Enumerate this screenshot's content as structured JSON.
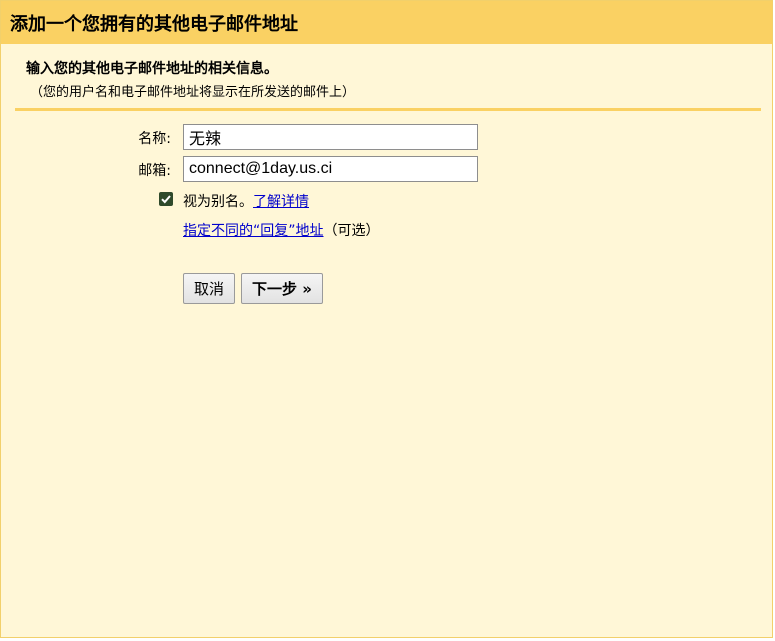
{
  "dialog": {
    "title": "添加一个您拥有的其他电子邮件地址",
    "heading": "输入您的其他电子邮件地址的相关信息。",
    "subheading": "（您的用户名和电子邮件地址将显示在所发送的邮件上）"
  },
  "form": {
    "name_label": "名称:",
    "name_value": "无辣",
    "email_label": "邮箱:",
    "email_value": "connect@1day.us.ci",
    "alias_checked": true,
    "alias_label": "视为别名。",
    "learn_more_link": "了解详情",
    "reply_to_link": "指定不同的“回复”地址",
    "optional_text": "（可选）"
  },
  "buttons": {
    "cancel_label": "取消",
    "next_label": "下一步 »"
  },
  "colors": {
    "title_bar": "#fad163",
    "panel_bg": "#fff7d7",
    "checkbox_fill": "#2f4a2b",
    "link": "#0000cc"
  }
}
